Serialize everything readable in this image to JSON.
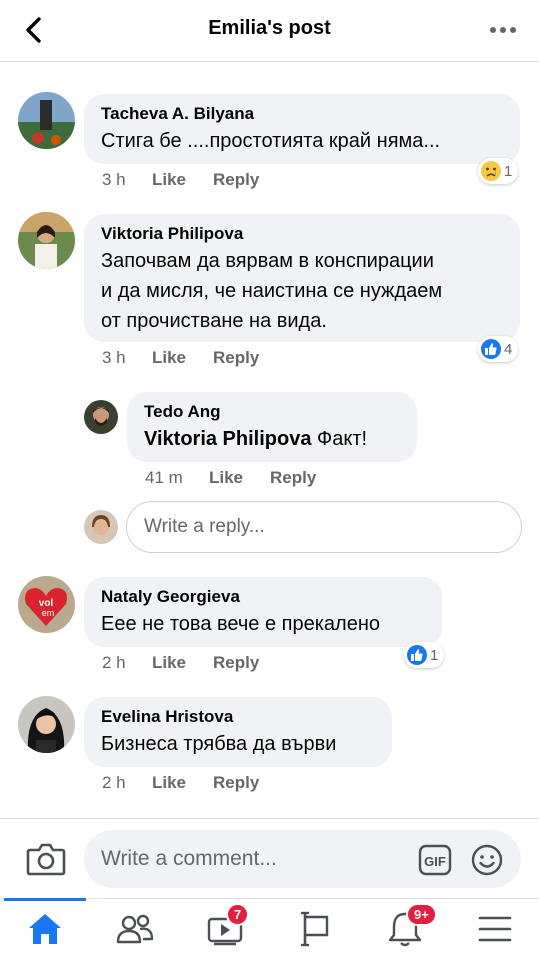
{
  "header": {
    "title": "Emilia's post"
  },
  "comments": [
    {
      "author": "Tacheva A. Bilyana",
      "text": "Стига бе ....простотията край няма...",
      "time": "3 h",
      "like": "Like",
      "reply": "Reply",
      "reaction": "sad",
      "reaction_count": "1"
    },
    {
      "author": "Viktoria Philipova",
      "text_lines": [
        "Започвам да вярвам в конспирации",
        "и да мисля, че наистина се нуждаем",
        "от прочистване на вида."
      ],
      "time": "3 h",
      "like": "Like",
      "reply": "Reply",
      "reaction": "like",
      "reaction_count": "4"
    },
    {
      "author": "Tedo Ang",
      "mention": "Viktoria Philipova",
      "text": " Факт!",
      "time": "41 m",
      "like": "Like",
      "reply": "Reply"
    },
    {
      "author": "Nataly Georgieva",
      "text": "Еее не това вече е прекалено",
      "time": "2 h",
      "like": "Like",
      "reply": "Reply",
      "reaction": "like",
      "reaction_count": "1"
    },
    {
      "author": "Evelina Hristova",
      "text": "Бизнеса трябва да върви",
      "time": "2 h",
      "like": "Like",
      "reply": "Reply"
    }
  ],
  "reply_input": {
    "placeholder": "Write a reply..."
  },
  "comment_bar": {
    "placeholder": "Write a comment...",
    "gif_label": "GIF"
  },
  "tabbar": {
    "tabs": [
      {
        "icon": "home-icon",
        "active": true
      },
      {
        "icon": "friends-icon"
      },
      {
        "icon": "watch-icon",
        "badge": "7"
      },
      {
        "icon": "pages-flag-icon"
      },
      {
        "icon": "notifications-bell-icon",
        "badge": "9+"
      },
      {
        "icon": "menu-icon"
      }
    ]
  },
  "colors": {
    "accent": "#1877f2",
    "bubble": "#f0f2f5",
    "badge": "#e41e3f",
    "meta": "#65676b"
  }
}
